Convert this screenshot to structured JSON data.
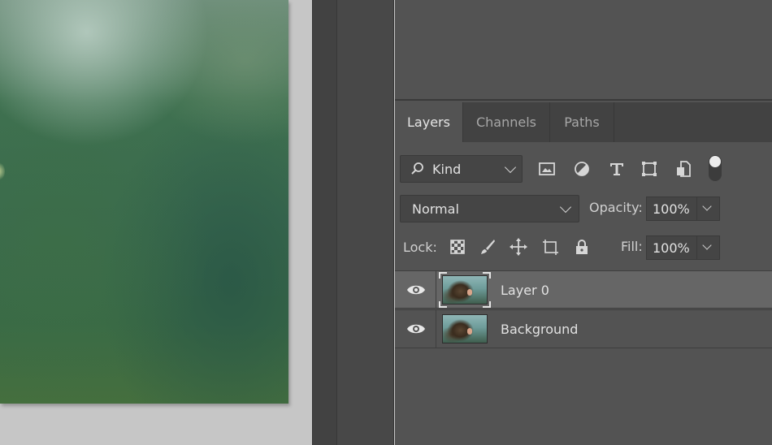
{
  "panel": {
    "tabs": [
      {
        "label": "Layers",
        "active": true
      },
      {
        "label": "Channels",
        "active": false
      },
      {
        "label": "Paths",
        "active": false
      }
    ],
    "filter": {
      "kind_label": "Kind",
      "icons": [
        "image-filter-icon",
        "adjustment-filter-icon",
        "type-filter-icon",
        "shape-filter-icon",
        "smart-object-filter-icon"
      ]
    },
    "blend_mode": "Normal",
    "opacity_label": "Opacity:",
    "opacity_value": "100%",
    "lock_label": "Lock:",
    "lock_icons": [
      "lock-transparent-pixels-icon",
      "lock-image-pixels-icon",
      "lock-position-icon",
      "lock-artboard-icon",
      "lock-all-icon"
    ],
    "fill_label": "Fill:",
    "fill_value": "100%",
    "layers": [
      {
        "name": "Layer 0",
        "visible": true,
        "selected": true
      },
      {
        "name": "Background",
        "visible": true,
        "selected": false
      }
    ]
  },
  "colors": {
    "panel_bg": "#535353",
    "tabbar_bg": "#424242",
    "selected_row": "#666666",
    "canvas_bg": "#c6c6c6"
  }
}
